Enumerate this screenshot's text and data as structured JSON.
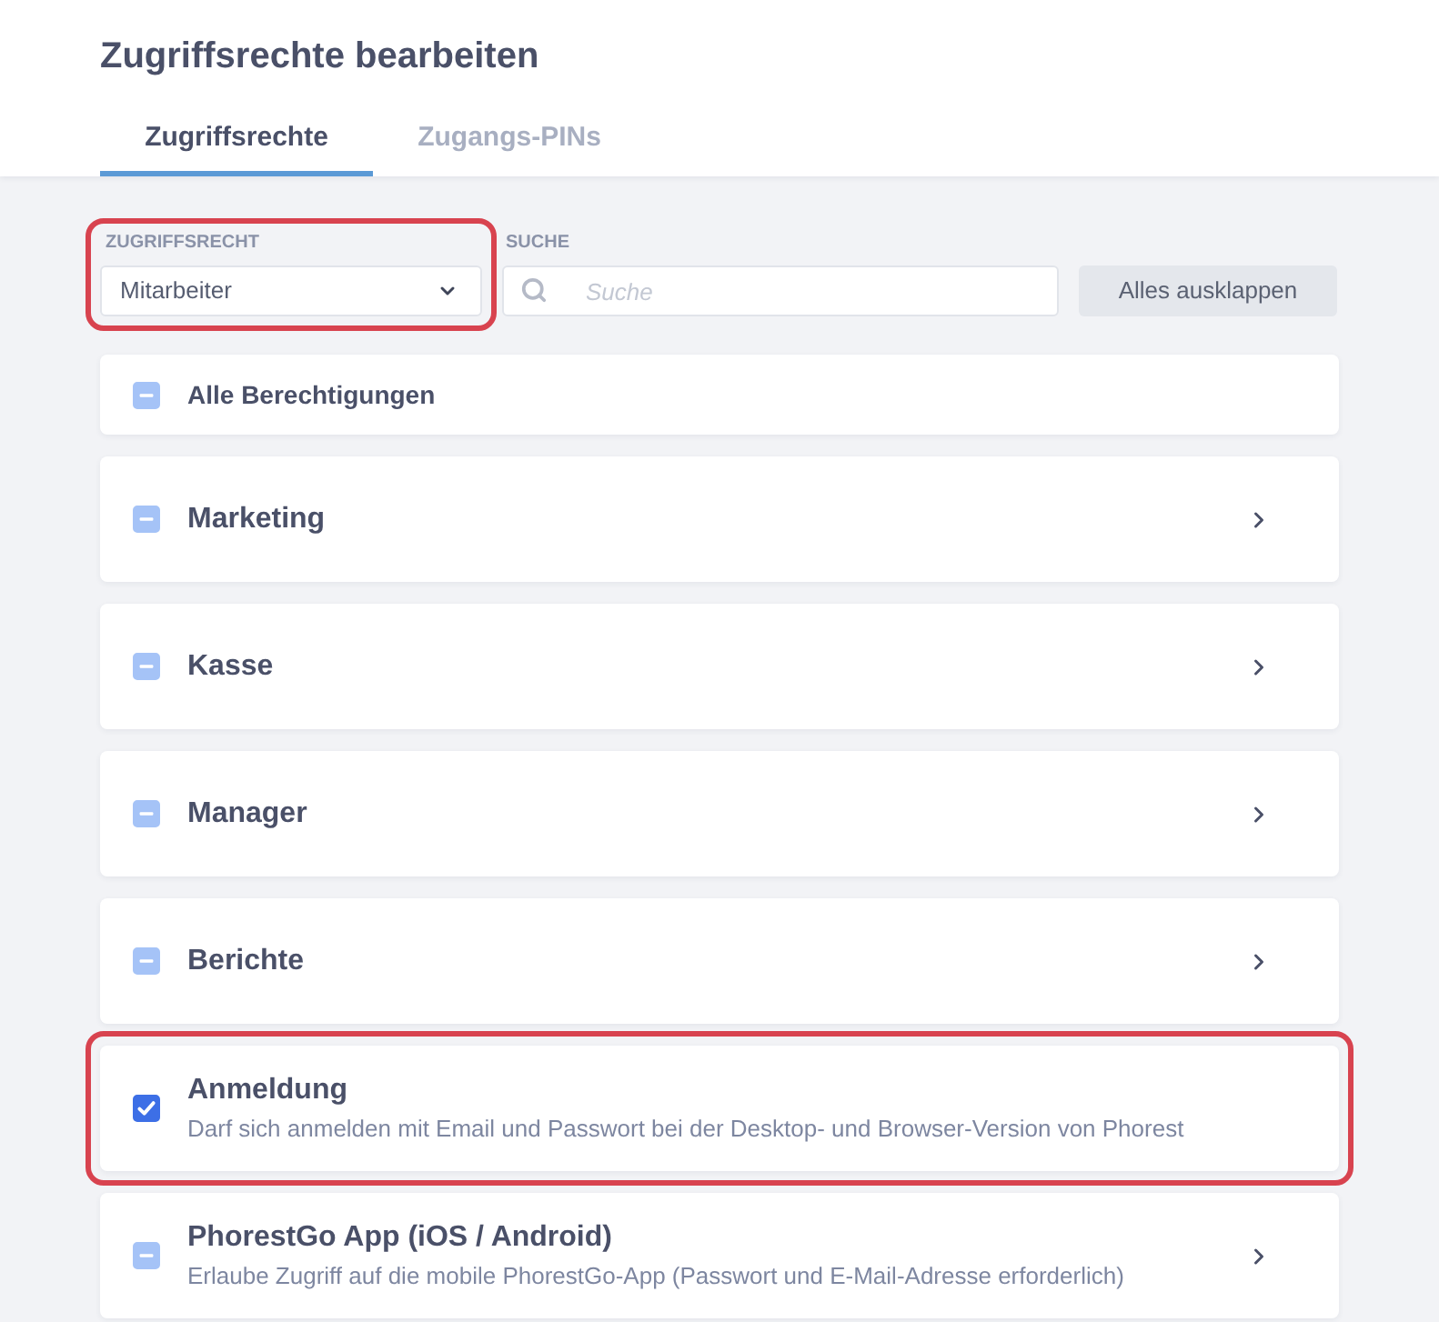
{
  "page": {
    "title": "Zugriffsrechte bearbeiten"
  },
  "tabs": [
    {
      "label": "Zugriffsrechte",
      "selected": true
    },
    {
      "label": "Zugangs-PINs",
      "selected": false
    }
  ],
  "filters": {
    "role": {
      "label": "ZUGRIFFSRECHT",
      "value": "Mitarbeiter",
      "highlighted": true
    },
    "search": {
      "label": "SUCHE",
      "placeholder": "Suche"
    },
    "expand_button": "Alles ausklappen"
  },
  "permissions": [
    {
      "kind": "all",
      "name": "Alle Berechtigungen",
      "checked": false,
      "mixed": true,
      "highlighted": false
    },
    {
      "kind": "group",
      "name": "Marketing",
      "checked": false,
      "mixed": true,
      "expandable": true,
      "highlighted": false
    },
    {
      "kind": "group",
      "name": "Kasse",
      "checked": false,
      "mixed": true,
      "expandable": true,
      "highlighted": false
    },
    {
      "kind": "group",
      "name": "Manager",
      "checked": false,
      "mixed": true,
      "expandable": true,
      "highlighted": false
    },
    {
      "kind": "group",
      "name": "Berichte",
      "checked": false,
      "mixed": true,
      "expandable": true,
      "highlighted": false
    },
    {
      "kind": "group",
      "name": "Anmeldung",
      "description": "Darf sich anmelden mit Email und Passwort bei der Desktop- und Browser-Version von Phorest",
      "checked": true,
      "mixed": false,
      "expandable": false,
      "highlighted": true
    },
    {
      "kind": "group",
      "name": "PhorestGo App (iOS / Android)",
      "description": "Erlaube Zugriff auf die mobile PhorestGo-App (Passwort und E-Mail-Adresse erforderlich)",
      "checked": false,
      "mixed": true,
      "expandable": true,
      "highlighted": false
    }
  ]
}
